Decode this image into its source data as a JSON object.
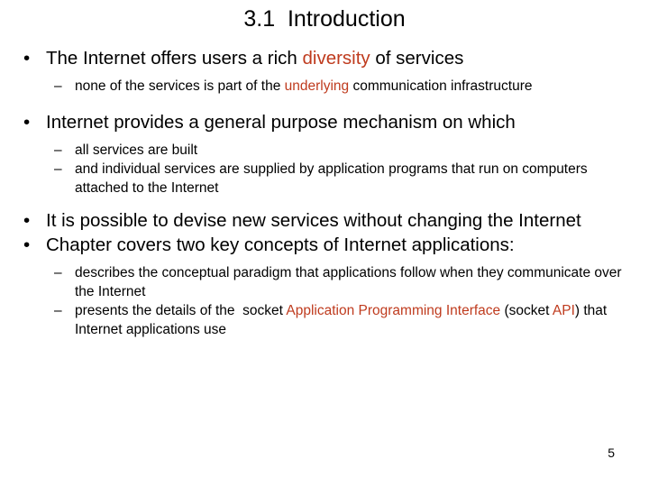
{
  "slide": {
    "title": "3.1  Introduction",
    "page_number": "5",
    "accent_color": "#BF3B1E",
    "background_color": "#FFFFFF",
    "text_color": "#000000",
    "bullet_glyph": "•",
    "dash_glyph": "–"
  },
  "content": {
    "b1": {
      "pre": "The Internet offers users a rich ",
      "accent": "diversity",
      "post": " of services"
    },
    "b1_s1": {
      "pre": "none of the services is part of the ",
      "accent": "underlying",
      "post": " communication infrastructure"
    },
    "b2": {
      "text": "Internet provides a general purpose mechanism on which"
    },
    "b2_s1": {
      "text": "all services are built"
    },
    "b2_s2": {
      "text": "and individual services are supplied by application programs that run on computers attached to the Internet"
    },
    "b3": {
      "text": "It is possible to devise new services without changing the Internet"
    },
    "b4": {
      "text": "Chapter covers two key concepts of Internet applications:"
    },
    "b4_s1": {
      "text": "describes the conceptual paradigm that applications follow when they communicate over the Internet"
    },
    "b4_s2": {
      "pre": "presents the details of the  socket ",
      "accent1": "Application Programming Interface",
      "mid": " (socket ",
      "accent2": "API",
      "post": ") that Internet applications use"
    }
  }
}
